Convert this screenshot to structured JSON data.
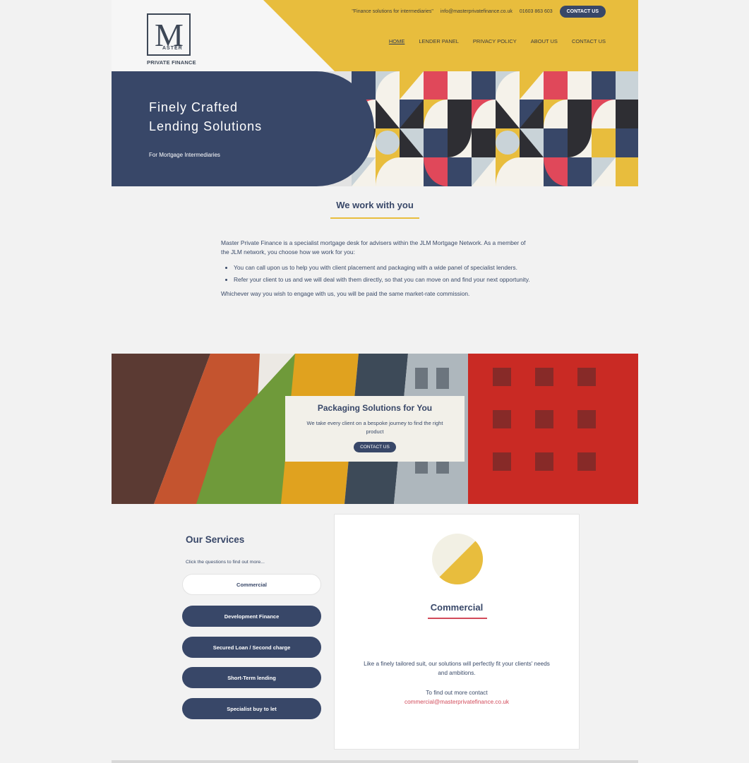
{
  "brand": {
    "logo_letter": "M",
    "logo_word": "ASTER",
    "logo_sub": "PRIVATE FINANCE"
  },
  "topbar": {
    "tagline": "\"Finance solutions for intermediaries\"",
    "email": "info@masterprivatefinance.co.uk",
    "phone": "01603 863 603",
    "cta_label": "CONTACT US"
  },
  "nav": {
    "items": [
      {
        "label": "HOME"
      },
      {
        "label": "LENDER PANEL"
      },
      {
        "label": "PRIVACY POLICY"
      },
      {
        "label": "ABOUT US"
      },
      {
        "label": "CONTACT US"
      }
    ]
  },
  "hero": {
    "title_line1": "Finely Crafted",
    "title_line2": "Lending Solutions",
    "subtitle": "For Mortgage Intermediaries"
  },
  "intro": {
    "heading": "We work with you",
    "paragraph1": "Master Private Finance is a specialist mortgage desk for advisers within the JLM Mortgage Network. As a member of the JLM network, you choose how we work for you:",
    "bullets": [
      "You can call upon us to help you with client placement and packaging with a wide panel of specialist lenders.",
      "Refer your client to us and we will deal with them directly, so that you can move on and find your next opportunity."
    ],
    "paragraph2": "Whichever way you wish to engage with us, you will be paid the same market-rate commission."
  },
  "banner": {
    "title": "Packaging Solutions for You",
    "text": "We take every client on a bespoke journey to find the right product",
    "button_label": "CONTACT US"
  },
  "services": {
    "title": "Our Services",
    "hint": "Click the questions to find out more...",
    "items": [
      {
        "label": "Commercial"
      },
      {
        "label": "Development Finance"
      },
      {
        "label": "Secured Loan / Second charge"
      },
      {
        "label": "Short-Term lending"
      },
      {
        "label": "Specialist buy to let"
      }
    ],
    "selected": {
      "title": "Commercial",
      "description": "Like a finely tailored suit, our solutions will perfectly fit your clients' needs and ambitions.",
      "contact_prefix": "To find out more contact",
      "contact_email": "commercial@masterprivatefinance.co.uk"
    }
  },
  "colors": {
    "navy": "#384768",
    "yellow": "#e8bd3d",
    "red": "#d24a5a",
    "cream": "#f2f0e9"
  }
}
